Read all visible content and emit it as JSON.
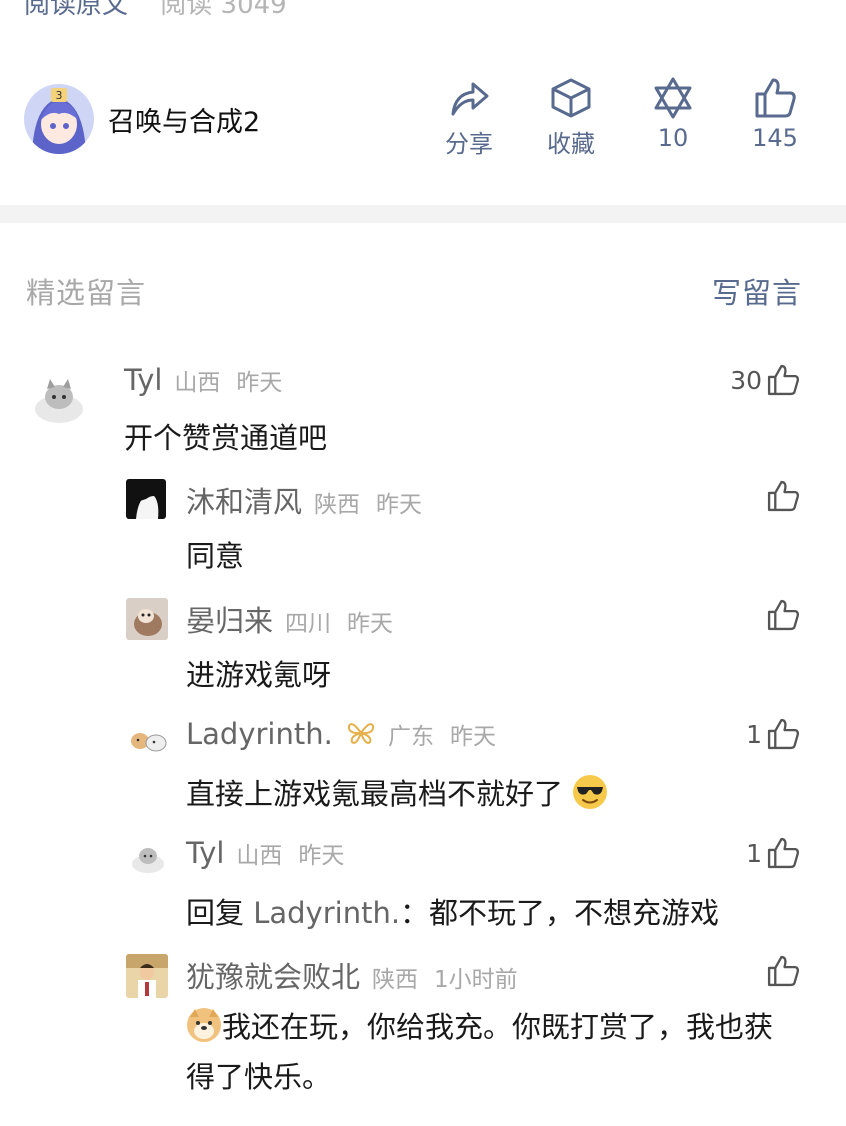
{
  "top": {
    "link": "阅读原文",
    "reads": "阅读 3049"
  },
  "author": {
    "name": "召唤与合成2"
  },
  "actions": {
    "share": "分享",
    "favorite": "收藏",
    "wow": "10",
    "likes": "145"
  },
  "section": {
    "title": "精选留言",
    "write": "写留言"
  },
  "comments": [
    {
      "name": "Tyl",
      "region": "山西",
      "time": "昨天",
      "likes": "30",
      "text": "开个赞赏通道吧"
    },
    {
      "name": "沐和清风",
      "region": "陕西",
      "time": "昨天",
      "likes": "",
      "text": "同意"
    },
    {
      "name": "晏归来",
      "region": "四川",
      "time": "昨天",
      "likes": "",
      "text": "进游戏氪呀"
    },
    {
      "name": "Ladyrinth.",
      "region": "广东",
      "time": "昨天",
      "likes": "1",
      "text": "直接上游戏氪最高档不就好了"
    },
    {
      "name": "Tyl",
      "region": "山西",
      "time": "昨天",
      "likes": "1",
      "reply_prefix": "回复 ",
      "reply_to": "Ladyrinth.",
      "text": "：都不玩了，不想充游戏"
    },
    {
      "name": "犹豫就会败北",
      "region": "陕西",
      "time": "1小时前",
      "likes": "",
      "text": "我还在玩，你给我充。你既打赏了，我也获得了快乐。"
    }
  ],
  "colors": {
    "link": "#596a8f",
    "muted": "#a8a8a8",
    "text": "#1a1a1a"
  }
}
